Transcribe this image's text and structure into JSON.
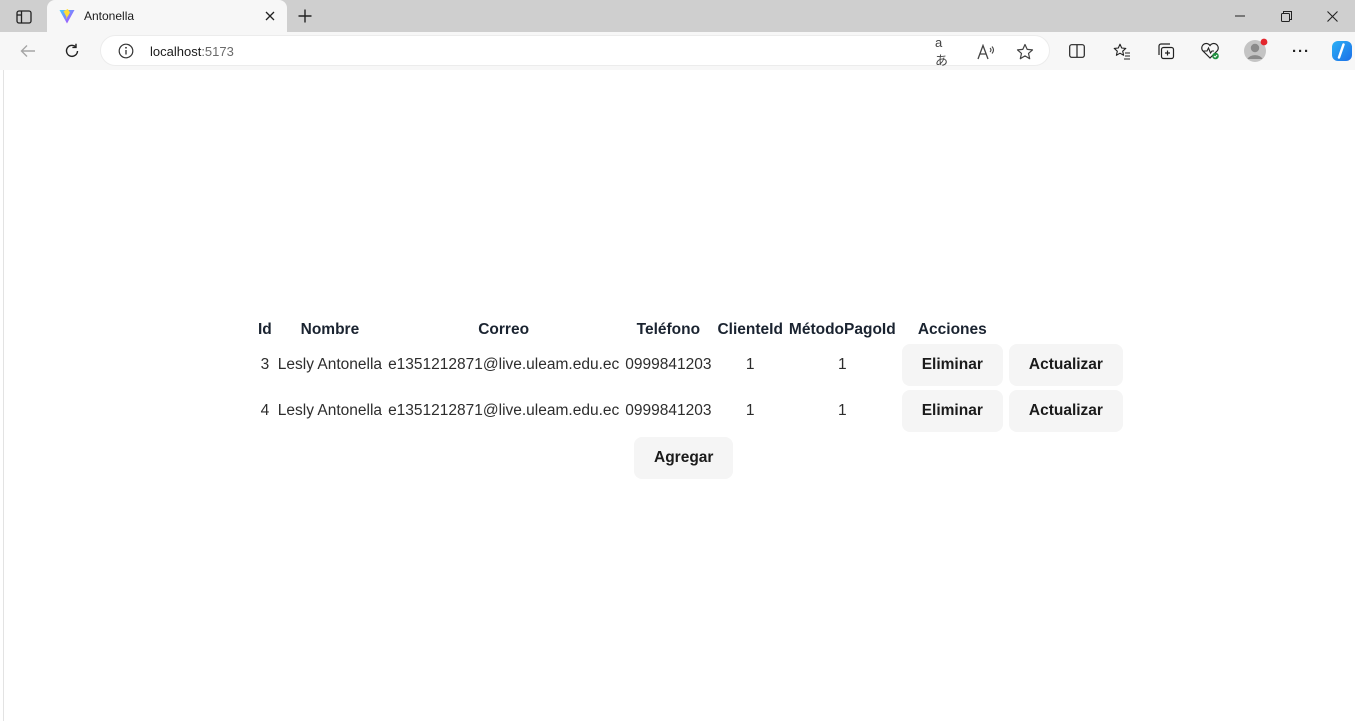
{
  "browser": {
    "tab": {
      "title": "Antonella",
      "close_glyph": "✕"
    },
    "new_tab_glyph": "+",
    "window": {
      "minimize_glyph": "—",
      "restore_glyph": "❐",
      "close_glyph": "✕"
    },
    "address": {
      "host": "localhost",
      "port": ":5173"
    },
    "icons": {
      "translate": "aあ",
      "read_aloud": "A",
      "favorite": "☆",
      "menu": "···"
    }
  },
  "table": {
    "headers": {
      "id": "Id",
      "nombre": "Nombre",
      "correo": "Correo",
      "telefono": "Teléfono",
      "cliente_id": "ClienteId",
      "metodo_pago_id": "MétodoPagoId",
      "acciones": "Acciones"
    },
    "rows": [
      {
        "id": "3",
        "nombre": "Lesly Antonella",
        "correo": "e1351212871@live.uleam.edu.ec",
        "telefono": "0999841203",
        "cliente_id": "1",
        "metodo_pago_id": "1",
        "delete_label": "Eliminar",
        "update_label": "Actualizar"
      },
      {
        "id": "4",
        "nombre": "Lesly Antonella",
        "correo": "e1351212871@live.uleam.edu.ec",
        "telefono": "0999841203",
        "cliente_id": "1",
        "metodo_pago_id": "1",
        "delete_label": "Eliminar",
        "update_label": "Actualizar"
      }
    ]
  },
  "add_button_label": "Agregar"
}
